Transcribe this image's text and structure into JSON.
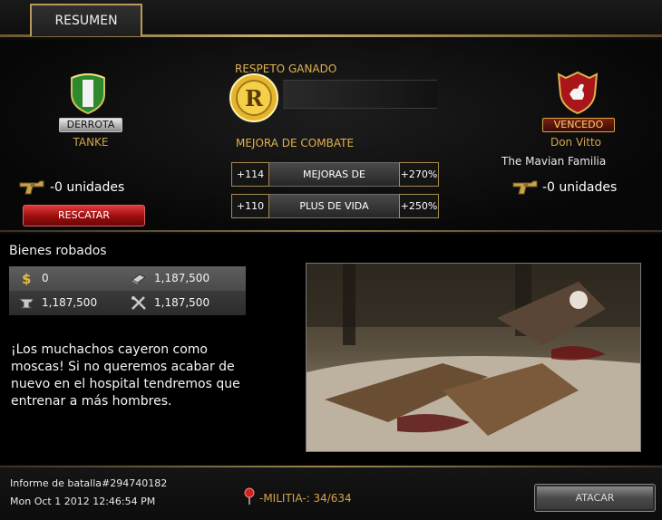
{
  "tabs": {
    "summary": "RESUMEN"
  },
  "loser": {
    "status": "DERROTA",
    "name": "TANKE",
    "units": "-0 unidades",
    "rescue_button": "RESCATAR",
    "badge_icon": "green-white-shield-icon"
  },
  "winner": {
    "status": "VENCEDO",
    "name": "Don Vitto",
    "family": "The Mavian Familia",
    "units": "-0 unidades",
    "badge_icon": "red-shield-eagle-icon"
  },
  "respect": {
    "label": "RESPETO GANADO",
    "coin_letter": "R"
  },
  "combat": {
    "label": "MEJORA DE COMBATE",
    "rows": [
      {
        "left": "+114",
        "name": "MEJORAS DE",
        "right": "+270%"
      },
      {
        "left": "+110",
        "name": "PLUS DE VIDA",
        "right": "+250%"
      }
    ]
  },
  "stolen": {
    "title": "Bienes robados",
    "items": [
      {
        "icon": "dollar-icon",
        "value": "0"
      },
      {
        "icon": "money-stack-icon",
        "value": "1,187,500"
      },
      {
        "icon": "anvil-icon",
        "value": "1,187,500"
      },
      {
        "icon": "crossed-tools-icon",
        "value": "1,187,500"
      }
    ]
  },
  "message": "¡Los muchachos cayeron como moscas! Si no queremos acabar de nuevo en el hospital tendremos que entrenar a más hombres.",
  "footer": {
    "report": "Informe de batalla#294740182",
    "date": "Mon Oct 1 2012 12:46:54 PM",
    "militia": "-MILITIA-: 34/634",
    "attack_button": "ATACAR"
  },
  "colors": {
    "gold": "#d4a54a",
    "accent_red": "#b01818",
    "border_gold": "#b89a5a"
  }
}
